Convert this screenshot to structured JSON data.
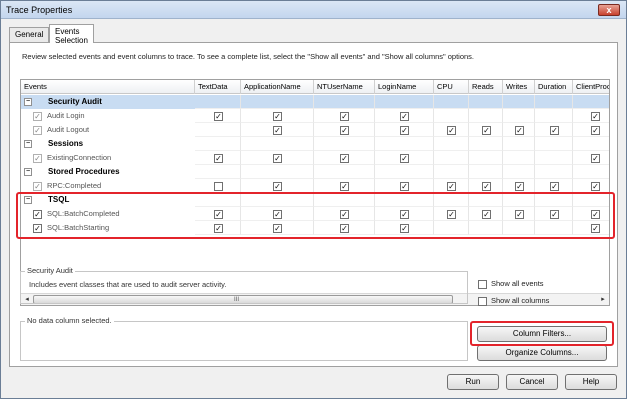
{
  "window": {
    "title": "Trace Properties",
    "close_glyph": "x"
  },
  "tabs": [
    {
      "label": "General",
      "active": false
    },
    {
      "label": "Events Selection",
      "active": true
    }
  ],
  "description": "Review selected events and event columns to trace. To see a complete list, select the \"Show all events\" and \"Show all columns\" options.",
  "grid": {
    "columns": [
      "Events",
      "TextData",
      "ApplicationName",
      "NTUserName",
      "LoginName",
      "CPU",
      "Reads",
      "Writes",
      "Duration",
      "ClientProcess"
    ],
    "rows": [
      {
        "type": "category",
        "name": "Security Audit",
        "selected": true,
        "expander": "−"
      },
      {
        "type": "event",
        "name": "Audit Login",
        "event_checked": true,
        "event_disabled": true,
        "cells": [
          true,
          true,
          true,
          true,
          null,
          null,
          null,
          null,
          true
        ]
      },
      {
        "type": "event",
        "name": "Audit Logout",
        "event_checked": true,
        "event_disabled": true,
        "cells": [
          null,
          true,
          true,
          true,
          true,
          true,
          true,
          true,
          true
        ]
      },
      {
        "type": "category",
        "name": "Sessions",
        "selected": false,
        "expander": "−"
      },
      {
        "type": "event",
        "name": "ExistingConnection",
        "event_checked": true,
        "event_disabled": true,
        "cells": [
          true,
          true,
          true,
          true,
          null,
          null,
          null,
          null,
          true
        ]
      },
      {
        "type": "category",
        "name": "Stored Procedures",
        "selected": false,
        "expander": "−"
      },
      {
        "type": "event",
        "name": "RPC:Completed",
        "event_checked": true,
        "event_disabled": true,
        "cells": [
          false,
          true,
          true,
          true,
          true,
          true,
          true,
          true,
          true
        ]
      },
      {
        "type": "category",
        "name": "TSQL",
        "selected": false,
        "expander": "−"
      },
      {
        "type": "event",
        "name": "SQL:BatchCompleted",
        "event_checked": true,
        "event_disabled": false,
        "cells": [
          true,
          true,
          true,
          true,
          true,
          true,
          true,
          true,
          true
        ]
      },
      {
        "type": "event",
        "name": "SQL:BatchStarting",
        "event_checked": true,
        "event_disabled": false,
        "cells": [
          true,
          true,
          true,
          true,
          null,
          null,
          null,
          null,
          true
        ]
      }
    ],
    "scroll_left": "◂",
    "scroll_right": "▸",
    "scroll_grip": "III"
  },
  "info_group": {
    "title": "Security Audit",
    "text": "Includes event classes that are used to audit server activity."
  },
  "column_group": {
    "title": "No data column selected."
  },
  "options": {
    "show_all_events": "Show all events",
    "show_all_columns": "Show all columns"
  },
  "buttons": {
    "column_filters": "Column Filters...",
    "organize_columns": "Organize Columns...",
    "run": "Run",
    "cancel": "Cancel",
    "help": "Help"
  },
  "highlight_color": "#e3242b"
}
